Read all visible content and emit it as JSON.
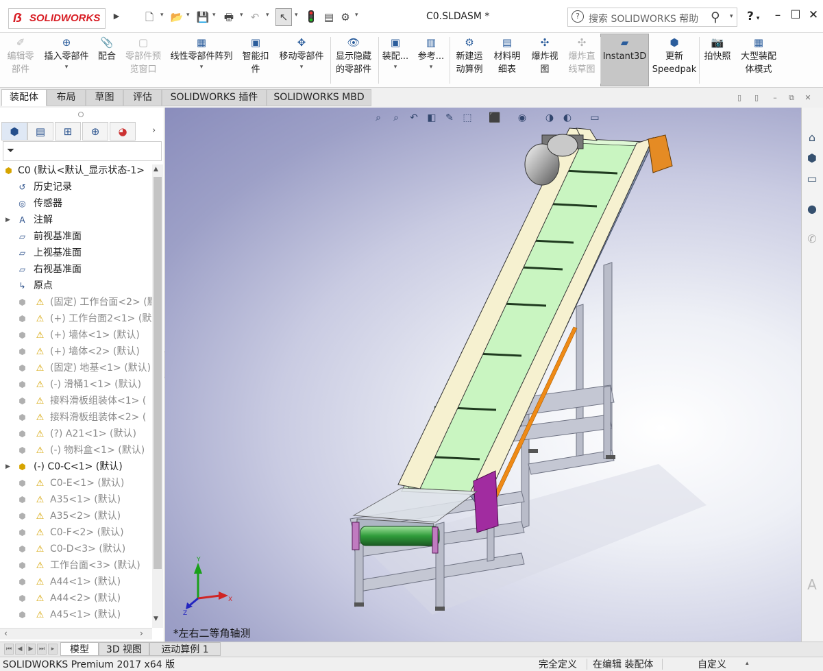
{
  "app": {
    "logo_text": "SOLIDWORKS",
    "document_title": "C0.SLDASM *",
    "search_placeholder": "搜索 SOLIDWORKS 帮助",
    "help_label": "?"
  },
  "toolbar": {
    "commands": [
      {
        "label": "编辑零\n部件",
        "enabled": false,
        "icon": "edit-component-icon"
      },
      {
        "label": "插入零部件",
        "enabled": true,
        "icon": "insert-component-icon",
        "dropdown": true
      },
      {
        "label": "配合",
        "enabled": true,
        "icon": "mate-icon"
      },
      {
        "label": "零部件预\n览窗口",
        "enabled": false,
        "icon": "preview-window-icon"
      },
      {
        "label": "线性零部件阵列",
        "enabled": true,
        "icon": "linear-pattern-icon",
        "dropdown": true
      },
      {
        "label": "智能扣\n件",
        "enabled": true,
        "icon": "smart-fastener-icon"
      },
      {
        "label": "移动零部件",
        "enabled": true,
        "icon": "move-component-icon",
        "dropdown": true
      },
      {
        "label": "显示隐藏\n的零部件",
        "enabled": true,
        "icon": "show-hidden-icon"
      },
      {
        "label": "装配...",
        "enabled": true,
        "icon": "assembly-features-icon",
        "dropdown": true
      },
      {
        "label": "参考...",
        "enabled": true,
        "icon": "reference-geometry-icon",
        "dropdown": true
      },
      {
        "label": "新建运\n动算例",
        "enabled": true,
        "icon": "new-motion-study-icon"
      },
      {
        "label": "材料明\n细表",
        "enabled": true,
        "icon": "bom-icon"
      },
      {
        "label": "爆炸视\n图",
        "enabled": true,
        "icon": "exploded-view-icon"
      },
      {
        "label": "爆炸直\n线草图",
        "enabled": false,
        "icon": "explode-line-sketch-icon"
      },
      {
        "label": "Instant3D",
        "enabled": true,
        "icon": "instant3d-icon",
        "active": true
      },
      {
        "label": "更新\nSpeedpak",
        "enabled": true,
        "icon": "speedpak-icon"
      },
      {
        "label": "拍快照",
        "enabled": true,
        "icon": "snapshot-icon"
      },
      {
        "label": "大型装配\n体模式",
        "enabled": true,
        "icon": "large-assembly-icon"
      }
    ]
  },
  "tabs": [
    "装配体",
    "布局",
    "草图",
    "评估",
    "SOLIDWORKS 插件",
    "SOLIDWORKS MBD"
  ],
  "active_tab": "装配体",
  "feature_tree": {
    "root": "C0  (默认<默认_显示状态-1>",
    "items": [
      {
        "label": "历史记录",
        "icon": "history-icon",
        "grey": false
      },
      {
        "label": "传感器",
        "icon": "sensor-icon",
        "grey": false
      },
      {
        "label": "注解",
        "icon": "annotations-icon",
        "grey": false,
        "expand": true
      },
      {
        "label": "前视基准面",
        "icon": "plane-icon",
        "grey": false
      },
      {
        "label": "上视基准面",
        "icon": "plane-icon",
        "grey": false
      },
      {
        "label": "右视基准面",
        "icon": "plane-icon",
        "grey": false
      },
      {
        "label": "原点",
        "icon": "origin-icon",
        "grey": false
      },
      {
        "label": "(固定) 工作台面<2> (默",
        "icon": "part-icon",
        "grey": true,
        "warn": true
      },
      {
        "label": "(+) 工作台面2<1> (默认",
        "icon": "part-icon",
        "grey": true,
        "warn": true
      },
      {
        "label": "(+) 墙体<1> (默认)",
        "icon": "part-icon",
        "grey": true,
        "warn": true
      },
      {
        "label": "(+) 墙体<2> (默认)",
        "icon": "part-icon",
        "grey": true,
        "warn": true
      },
      {
        "label": "(固定) 地基<1> (默认)",
        "icon": "part-icon",
        "grey": true,
        "warn": true
      },
      {
        "label": "(-) 滑桶1<1> (默认)",
        "icon": "part-icon",
        "grey": true,
        "warn": true
      },
      {
        "label": "接料滑板组装体<1> (",
        "icon": "part-icon",
        "grey": true,
        "warn": true
      },
      {
        "label": "接料滑板组装体<2> (",
        "icon": "part-icon",
        "grey": true,
        "warn": true
      },
      {
        "label": "(?) A21<1> (默认)",
        "icon": "part-icon",
        "grey": true,
        "warn": true
      },
      {
        "label": "(-) 物料盒<1> (默认)",
        "icon": "part-icon",
        "grey": true,
        "warn": true
      },
      {
        "label": "(-) C0-C<1> (默认)",
        "icon": "subassembly-icon",
        "grey": false,
        "expand": true
      },
      {
        "label": "C0-E<1> (默认)",
        "icon": "part-icon",
        "grey": true,
        "warn": true
      },
      {
        "label": "A35<1> (默认)",
        "icon": "part-icon",
        "grey": true,
        "warn": true
      },
      {
        "label": "A35<2> (默认)",
        "icon": "part-icon",
        "grey": true,
        "warn": true
      },
      {
        "label": "C0-F<2> (默认)",
        "icon": "part-icon",
        "grey": true,
        "warn": true
      },
      {
        "label": "C0-D<3> (默认)",
        "icon": "part-icon",
        "grey": true,
        "warn": true
      },
      {
        "label": "工作台面<3> (默认)",
        "icon": "part-icon",
        "grey": true,
        "warn": true
      },
      {
        "label": "A44<1> (默认)",
        "icon": "part-icon",
        "grey": true,
        "warn": true
      },
      {
        "label": "A44<2> (默认)",
        "icon": "part-icon",
        "grey": true,
        "warn": true
      },
      {
        "label": "A45<1> (默认)",
        "icon": "part-icon",
        "grey": true,
        "warn": true
      }
    ]
  },
  "viewport": {
    "view_label": "*左右二等角轴测"
  },
  "bottom_tabs": [
    "模型",
    "3D 视图",
    "运动算例 1"
  ],
  "active_bottom_tab": "模型",
  "status": {
    "product": "SOLIDWORKS Premium 2017 x64 版",
    "definition": "完全定义",
    "editing": "在编辑 装配体",
    "units": "自定义"
  },
  "colors": {
    "brand_red": "#d81d24",
    "belt_green": "#c9f5c1",
    "frame_cream": "#f6f1d0",
    "warning_yellow": "#d6a400"
  }
}
